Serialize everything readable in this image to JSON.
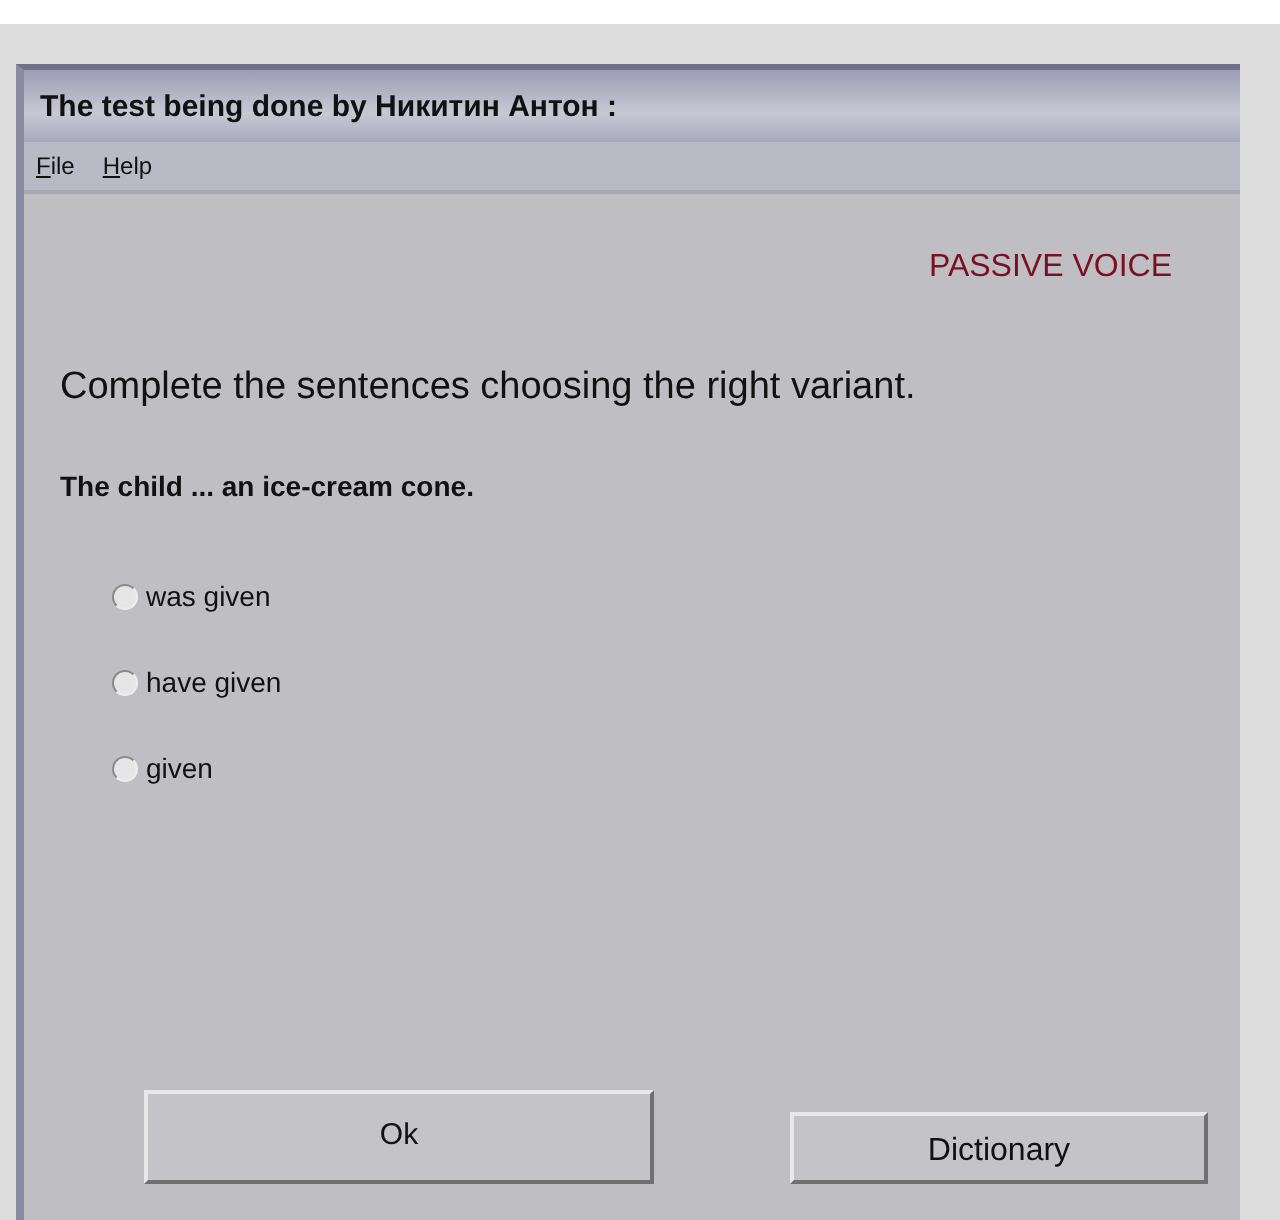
{
  "window": {
    "title": "The test being done by Никитин Антон :"
  },
  "menu": [
    "File",
    "Help"
  ],
  "topic": "PASSIVE VOICE",
  "instruction": "Complete the sentences choosing the right variant.",
  "question": "The child ... an ice-cream cone.",
  "options": [
    {
      "label": "was given",
      "selected": false
    },
    {
      "label": "have given",
      "selected": false
    },
    {
      "label": "given",
      "selected": false
    }
  ],
  "buttons": [
    {
      "label": "Ok",
      "kind": "primary"
    },
    {
      "label": "Dictionary",
      "kind": "secondary"
    }
  ]
}
